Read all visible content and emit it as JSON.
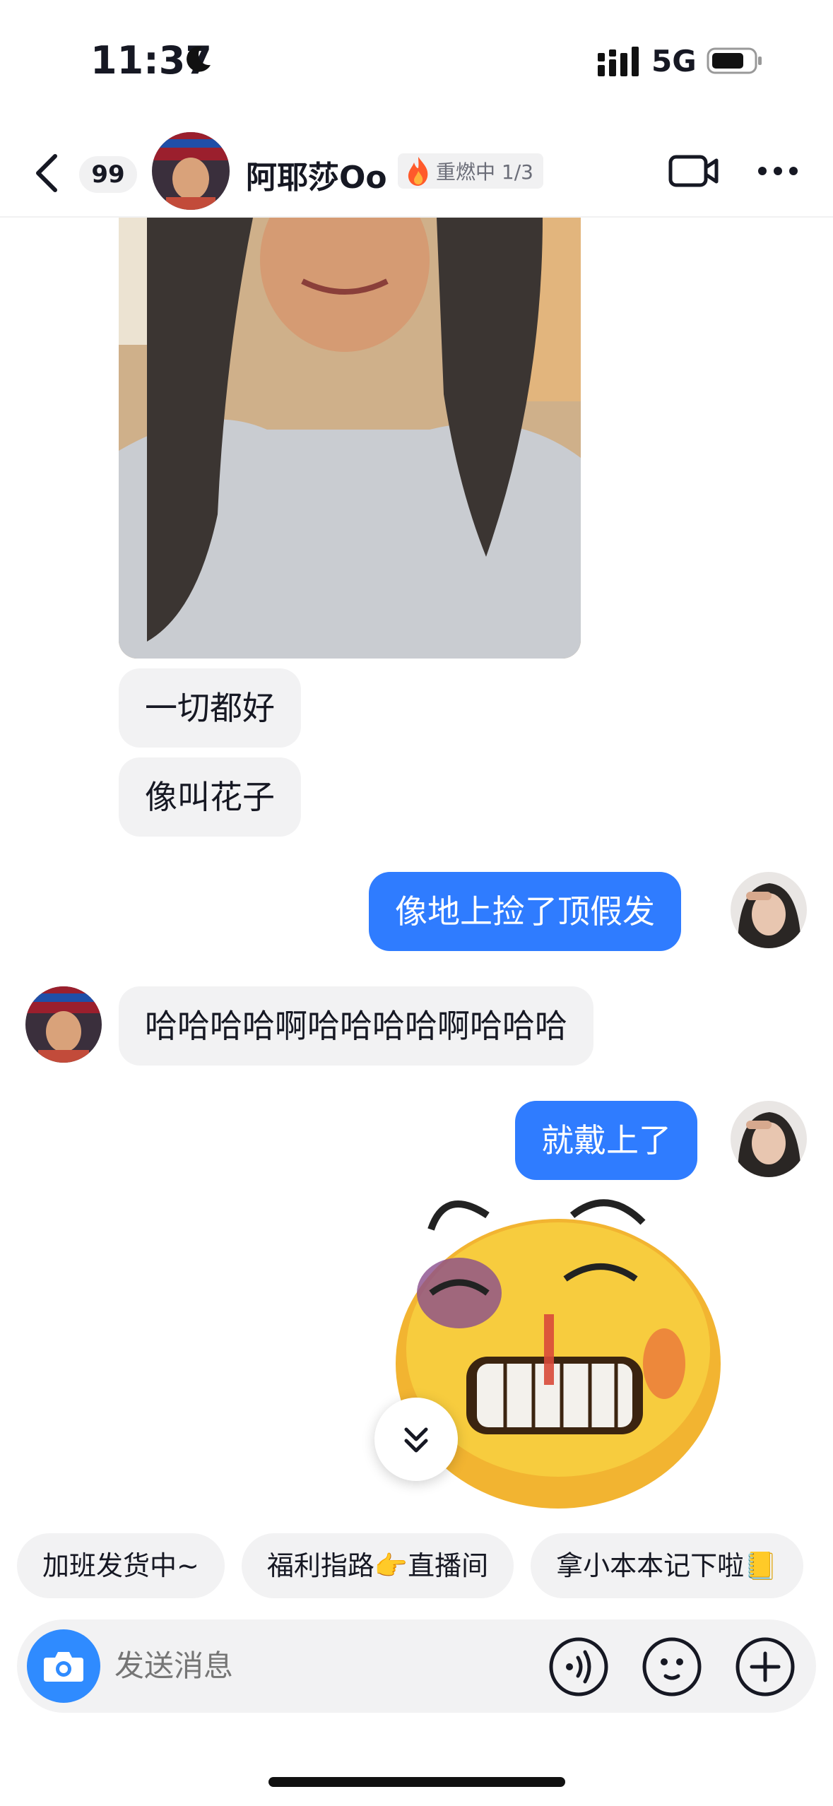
{
  "status": {
    "time": "11:37",
    "network": "5G"
  },
  "header": {
    "unread_count": "99",
    "contact_name": "阿耶莎Oo",
    "streak_label": "重燃中 1/3"
  },
  "messages": {
    "m1": "一切都好",
    "m2": "像叫花子",
    "m3": "像地上捡了顶假发",
    "m4": "哈哈哈哈啊哈哈哈哈啊哈哈哈",
    "m5": "就戴上了"
  },
  "quick_replies": [
    "加班发货中~",
    "福利指路👉直播间",
    "拿小本本记下啦📒"
  ],
  "input": {
    "placeholder": "发送消息"
  },
  "colors": {
    "accent": "#2f7cff",
    "bubble_in": "#f2f2f3",
    "camera": "#2f8bff"
  },
  "icons": [
    "moon-icon",
    "signal-icon",
    "battery-icon",
    "back-arrow-icon",
    "flame-icon",
    "video-call-icon",
    "more-icon",
    "chevron-double-down-icon",
    "camera-icon",
    "voice-icon",
    "emoji-icon",
    "plus-icon"
  ]
}
